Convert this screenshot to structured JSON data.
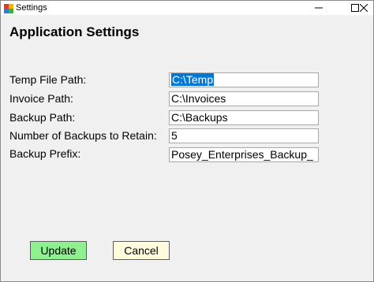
{
  "window": {
    "title": "Settings"
  },
  "heading": "Application Settings",
  "fields": [
    {
      "label": "Temp File Path:",
      "value": "C:\\Temp"
    },
    {
      "label": "Invoice Path:",
      "value": "C:\\Invoices"
    },
    {
      "label": "Backup Path:",
      "value": "C:\\Backups"
    },
    {
      "label": "Number of Backups to Retain:",
      "value": "5"
    },
    {
      "label": "Backup Prefix:",
      "value": "Posey_Enterprises_Backup_"
    }
  ],
  "buttons": {
    "update": "Update",
    "cancel": "Cancel"
  },
  "colors": {
    "update_bg": "#8ef08e",
    "cancel_bg": "#fffbdc",
    "selection": "#0078d7"
  }
}
